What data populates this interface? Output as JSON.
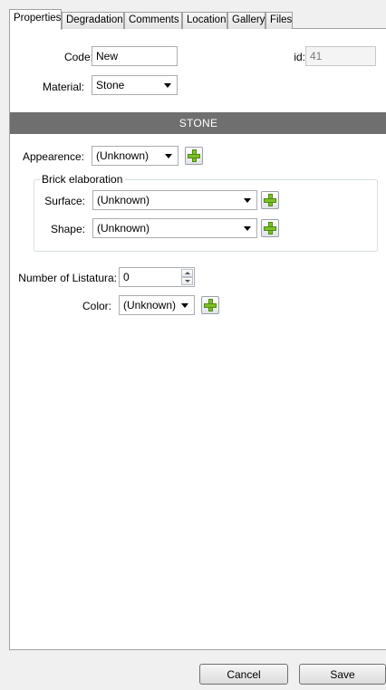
{
  "tabs": [
    {
      "label": "Properties",
      "active": true
    },
    {
      "label": "Degradation",
      "active": false
    },
    {
      "label": "Comments",
      "active": false
    },
    {
      "label": "Location",
      "active": false
    },
    {
      "label": "Gallery",
      "active": false
    },
    {
      "label": "Files",
      "active": false
    }
  ],
  "form": {
    "code_label": "Code:",
    "code_value": "New",
    "id_label": "id:",
    "id_value": "41",
    "material_label": "Material:",
    "material_value": "Stone"
  },
  "section": {
    "title": "STONE"
  },
  "appearance": {
    "label": "Appearence:",
    "value": "(Unknown)"
  },
  "brick_elaboration": {
    "legend": "Brick elaboration",
    "surface_label": "Surface:",
    "surface_value": "(Unknown)",
    "shape_label": "Shape:",
    "shape_value": "(Unknown)"
  },
  "listatura": {
    "number_label": "Number of Listatura:",
    "number_value": "0",
    "color_label": "Color:",
    "color_value": "(Unknown)"
  },
  "footer": {
    "cancel_label": "Cancel",
    "save_label": "Save"
  },
  "colors": {
    "section_bar": "#6f6f6f",
    "add_icon_green": "#7cc127"
  },
  "icons": [
    "plus-icon",
    "dropdown-arrow-icon",
    "spin-up-icon",
    "spin-down-icon"
  ]
}
